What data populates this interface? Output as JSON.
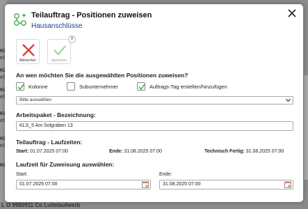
{
  "background": {
    "left_fragments": [
      "KL",
      "eS",
      "KL",
      "eS",
      "KL",
      "eS",
      "KL",
      "eS",
      "KL",
      "eS",
      "KL"
    ],
    "bottom_text": "L O 9980911 Co Luitelaufwerb"
  },
  "dialog": {
    "title": "Teilauftrag - Positionen zuweisen",
    "subtitle": "Hausanschlüsse"
  },
  "toolbar": {
    "cancel_label": "Abbrechen",
    "save_label": "Speichern",
    "save_badge": "8"
  },
  "assign": {
    "question": "An wen möchten Sie die ausgewählten Positionen zuweisen?",
    "options": [
      {
        "label": "Kolonne",
        "checked": true
      },
      {
        "label": "Subunternehmer",
        "checked": false
      },
      {
        "label": "Auftrags-Tag erstellen/hinzufügen",
        "checked": true
      }
    ],
    "select_value": "Bitte auswählen"
  },
  "work_package": {
    "label": "Arbeitspaket - Bezeichnung:",
    "value": "KLS_5 Am Solgraben 13"
  },
  "runtimes": {
    "label": "Teilauftrag - Laufzeiten:",
    "start_label": "Start:",
    "start_value": "01.07.2025 07:00",
    "end_label": "Ende:",
    "end_value": "31.08.2025 07:00",
    "tech_label": "Technisch Fertig:",
    "tech_value": "31.08.2025 07:00"
  },
  "assignment_period": {
    "label": "Laufzeit für Zuweisung auswählen:",
    "start_label": "Start:",
    "start_value": "01.07.2025 07:00",
    "end_label": "Ende:",
    "end_value": "31.08.2025 07:00"
  },
  "colors": {
    "accent_green": "#4caf50",
    "cancel_red": "#e53935",
    "link_blue": "#1a3c8f"
  }
}
